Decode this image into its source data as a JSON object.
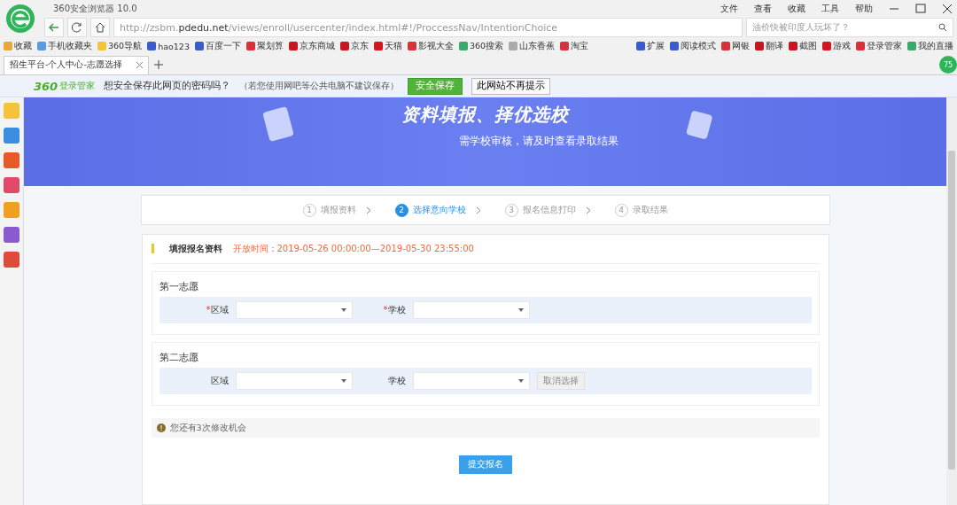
{
  "browser": {
    "title": "360安全浏览器 10.0",
    "menu": [
      "文件",
      "查看",
      "收藏",
      "工具",
      "帮助"
    ],
    "url_prefix": "http://zsbm.",
    "url_domain": "pdedu.net",
    "url_path": "/views/enroll/usercenter/index.html#!/ProccessNav/IntentionChoice",
    "search_placeholder": "油价快被印度人玩坏了？",
    "bookmarks": [
      {
        "label": "收藏"
      },
      {
        "label": "手机收藏夹"
      },
      {
        "label": "360导航"
      },
      {
        "label": "hao123"
      },
      {
        "label": "百度一下"
      },
      {
        "label": "聚划算"
      },
      {
        "label": "京东商城"
      },
      {
        "label": "京东"
      },
      {
        "label": "天猫"
      },
      {
        "label": "影视大全"
      },
      {
        "label": "360搜索"
      },
      {
        "label": "山东香蕉"
      },
      {
        "label": "淘宝"
      }
    ],
    "tools": [
      "扩展",
      "阅读模式",
      "网银",
      "翻译",
      "截图",
      "游戏",
      "登录管家",
      "我的直播"
    ],
    "tab_title": "招生平台-个人中心-志愿选择",
    "badge": "75"
  },
  "password_bar": {
    "brand": "360",
    "product": "登录管家",
    "question": "想安全保存此网页的密码吗？",
    "note": "（若您使用网吧等公共电脑不建议保存）",
    "save_button": "安全保存",
    "never_button": "此网站不再提示"
  },
  "banner": {
    "title": "资料填报、择优选校",
    "subtitle": "需学校审核，请及时查看录取结果"
  },
  "steps": [
    {
      "number": "1",
      "label": "填报资料",
      "selected": false
    },
    {
      "number": "2",
      "label": "选择意向学校",
      "selected": true
    },
    {
      "number": "3",
      "label": "报名信息打印",
      "selected": false
    },
    {
      "number": "4",
      "label": "录取结果",
      "selected": false
    }
  ],
  "form": {
    "section_title": "填报报名资料",
    "open_time": "开放时间：2019-05-26 00:00:00—2019-05-30 23:55:00",
    "choices": [
      {
        "title": "第一志愿",
        "fields": [
          {
            "label": "区域",
            "mark": "*"
          },
          {
            "label": "学校",
            "mark": "*"
          }
        ]
      },
      {
        "title": "第二志愿",
        "fields": [
          {
            "label": "区域"
          },
          {
            "label": "学校"
          }
        ],
        "cancel_button": "取消选择"
      }
    ],
    "notice": "您还有3次修改机会",
    "submit": "提交报名"
  }
}
